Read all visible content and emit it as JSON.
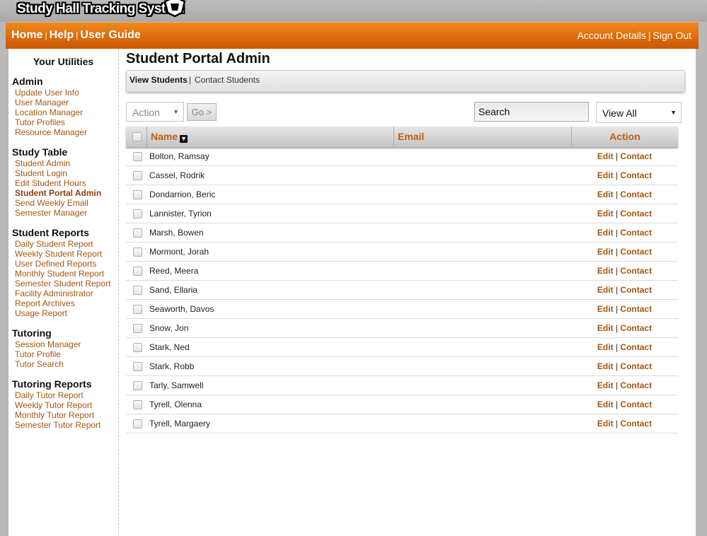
{
  "logo": {
    "text": "Study Hall Tracking System"
  },
  "nav": {
    "home": "Home",
    "help": "Help",
    "user_guide": "User Guide",
    "sep": "|",
    "account_details": "Account Details",
    "sign_out": "Sign Out"
  },
  "sidebar": {
    "title": "Your Utilities",
    "sections": [
      {
        "title": "Admin",
        "links": [
          "Update User Info",
          "User Manager",
          "Location Manager",
          "Tutor Profiles",
          "Resource Manager"
        ]
      },
      {
        "title": "Study Table",
        "links": [
          "Student Admin",
          "Student Login",
          "Edit Student Hours",
          "Student Portal Admin",
          "Send Weekly Email",
          "Semester Manager"
        ]
      },
      {
        "title": "Student Reports",
        "links": [
          "Daily Student Report",
          "Weekly Student Report",
          "User Defined Reports",
          "Monthly Student Report",
          "Semester Student Report",
          "Facility Administrator",
          "Report Archives",
          "Usage Report"
        ]
      },
      {
        "title": "Tutoring",
        "links": [
          "Session Manager",
          "Tutor Profile",
          "Tutor Search"
        ]
      },
      {
        "title": "Tutoring Reports",
        "links": [
          "Daily Tutor Report",
          "Weekly Tutor Report",
          "Monthly Tutor Report",
          "Semester Tutor Report"
        ]
      }
    ],
    "active_link": "Student Portal Admin"
  },
  "main": {
    "title": "Student Portal Admin",
    "tabs": {
      "active": "View Students",
      "sep": "|",
      "other": "Contact Students"
    },
    "action_select": {
      "value": "Action"
    },
    "go_button": "Go >",
    "search": {
      "placeholder": "Search"
    },
    "view_select": {
      "value": "View All"
    },
    "columns": {
      "name": "Name",
      "email": "Email",
      "action": "Action"
    },
    "row_actions": {
      "edit": "Edit",
      "sep": "|",
      "contact": "Contact"
    },
    "students": [
      "Bolton, Ramsay",
      "Cassel, Rodrik",
      "Dondarrion, Beric",
      "Lannister, Tyrion",
      "Marsh, Bowen",
      "Mormont, Jorah",
      "Reed, Meera",
      "Sand, Ellaria",
      "Seaworth, Davos",
      "Snow, Jon",
      "Stark, Ned",
      "Stark, Robb",
      "Tarly, Samwell",
      "Tyrell, Olenna",
      "Tyrell, Margaery"
    ]
  },
  "colors": {
    "brand_orange": "#e0750f",
    "link_brown": "#a4560f"
  }
}
